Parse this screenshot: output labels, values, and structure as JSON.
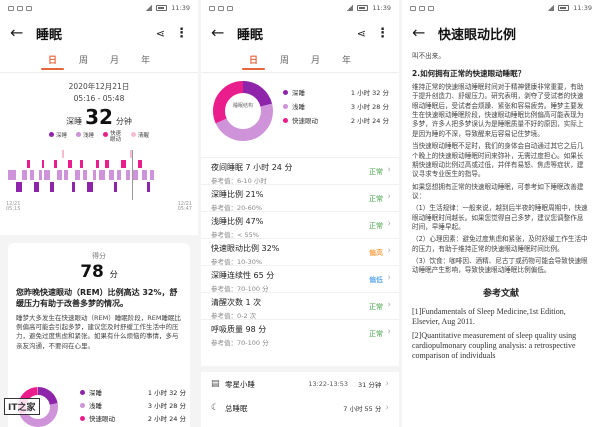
{
  "status": {
    "time": "11:39"
  },
  "panel1": {
    "title": "睡眠",
    "tabs": [
      "日",
      "周",
      "月",
      "年"
    ],
    "date": "2020年12月21日",
    "time_range": "05:16 - 05:48",
    "deep_label": "深睡",
    "deep_value": "32",
    "deep_unit": "分钟",
    "legend": [
      "深睡",
      "浅睡",
      "快速眼动",
      "清醒"
    ],
    "axis_left": [
      "12/21",
      "05:15"
    ],
    "axis_right": [
      "12/21",
      "05:47"
    ],
    "score_label": "得分",
    "score_value": "78",
    "score_unit": "分",
    "summary": "您昨晚快速眼动（REM）比例高达 32%，舒缓压力有助于改善多梦的情况。",
    "detail": "睡梦大多发生在快速眼动（REM）睡眠阶段，REM睡眠比例偏高可能会引起多梦，建议您及时舒缓工作生活中的压力，避免过度焦虑和紧张。如果有什么烦恼的事情，多与亲友沟通，不要闷在心里。"
  },
  "panel2": {
    "title": "睡眠",
    "tabs": [
      "日",
      "周",
      "月",
      "年"
    ],
    "donut_center": "睡眠结构",
    "donut_legend": [
      {
        "name": "深睡",
        "value": "1 小时 32 分"
      },
      {
        "name": "浅睡",
        "value": "3 小时 28 分"
      },
      {
        "name": "快速眼动",
        "value": "2 小时 24 分"
      }
    ],
    "metrics": [
      {
        "name": "夜间睡眠  7 小时 24 分",
        "ref": "参考值：6-10 小时",
        "status": "正常",
        "kind": "normal"
      },
      {
        "name": "深睡比例  21%",
        "ref": "参考值：20-60%",
        "status": "正常",
        "kind": "normal"
      },
      {
        "name": "浅睡比例  47%",
        "ref": "参考值：< 55%",
        "status": "正常",
        "kind": "normal"
      },
      {
        "name": "快速眼动比例  32%",
        "ref": "参考值：10-30%",
        "status": "偏高",
        "kind": "high"
      },
      {
        "name": "深睡连续性  65 分",
        "ref": "参考值：70-100 分",
        "status": "偏低",
        "kind": "low"
      },
      {
        "name": "清醒次数  1 次",
        "ref": "参考值：0-2 次",
        "status": "正常",
        "kind": "normal"
      },
      {
        "name": "呼吸质量  98 分",
        "ref": "参考值：70-100 分",
        "status": "正常",
        "kind": "normal"
      }
    ],
    "nap": {
      "label": "零星小睡",
      "time": "13:22-13:53",
      "value": "31 分钟"
    },
    "total": {
      "label": "总睡眠",
      "value": "7 小时 55 分"
    }
  },
  "panel3": {
    "heading": "快速眼动比例",
    "lead": "叫不出来。",
    "q2": "2.如何拥有正常的快速眼动睡眠？",
    "p1": "维持正常的快速眼动睡眠时间对于精神健康非常重要，有助于提升创造力、舒缓压力。研究表明，剥夺了受试者的快速眼动睡眠后，受试者会烦躁、紧张和容易疲劳。睡梦主要发生在快速眼动睡眠阶段，快速眼动睡眠比例偏高可能表现为多梦，许多人把多梦误认为是睡眠质量不好的原因，实际上是因为睡的不深，导致醒来后容易记住梦境。",
    "p2": "当快速眼动睡眠不足时，我们的身体会自动通过其它之后几个晚上的快速眼动睡眠时间来弥补，无需过度担心。如果长期快速眼动比例过高或过低，并伴有易怒、焦虑等症状，建议寻求专业医生的指导。",
    "p3": "如果您想拥有正常的快速眼动睡眠，可参考如下睡眠改善建议：",
    "p4": "（1）生活规律：一般来说，越到后半夜的睡眠周期中，快速眼动睡眠时间越长。如果您觉得自己多梦，建议您调整作息时间，早睡早起。",
    "p5": "（2）心理因素：避免过度焦虑和紧张，及时舒缓工作生活中的压力，有助于维持正常的快速眼动睡眠时间比例。",
    "p6": "（3）饮食：咖啡因、酒精、尼古丁或药物可能会导致快速眼动睡眠产生影响，导致快速眼动睡眠比例偏低。",
    "refs_title": "参考文献",
    "refs": [
      "[1]Fundamentals of Sleep Medicine,1st Edition, Elsevier, Aug 2011.",
      "[2]Quantitative measurement of sleep quality using cardiopulmonary coupling analysis: a retrospective comparison of individuals"
    ]
  },
  "watermark": "IT之家"
}
